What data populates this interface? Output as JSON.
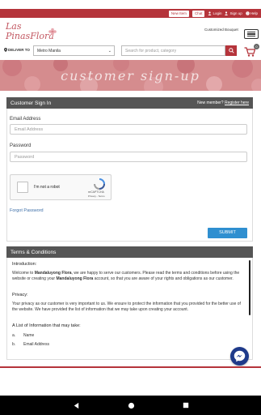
{
  "topbar": {
    "badge": "New Item",
    "chat": "Chat",
    "login": "Login",
    "signup": "Sign up",
    "help": "Help"
  },
  "header": {
    "logo_line1": "Las",
    "logo_line2": "PinasFlora",
    "custom_bouquet": "Customized Bouquet",
    "cart_count": "0"
  },
  "search": {
    "deliver_label": "DELIVER TO",
    "city_value": "Metro Manila",
    "placeholder": "Search for product, category"
  },
  "banner": {
    "title": "customer sign-up"
  },
  "signin": {
    "title": "Customer Sign In",
    "new_member": "New member?",
    "register": "Register here",
    "email_label": "Email Address",
    "email_placeholder": "Email Address",
    "password_label": "Password",
    "password_placeholder": "Password",
    "captcha_label": "I'm not a robot",
    "captcha_brand": "reCAPTCHA",
    "captcha_terms": "Privacy - Terms",
    "forgot": "Forgot Password",
    "submit": "SUBMIT"
  },
  "terms": {
    "title": "Terms & Conditions",
    "intro_heading": "Introduction:",
    "intro_text_a": "Welcome to ",
    "intro_brand_a": "Mandaluyong Flora",
    "intro_text_b": ", we are happy to serve our customers. Please read the terms and conditions before using the website or creating your ",
    "intro_brand_b": "Mandaluyong Flora",
    "intro_text_c": " account, so that you are aware of your rights and obligations as our customer.",
    "privacy_heading": "Privacy:",
    "privacy_text": "Your privacy as our customer is very important to us. We ensure to protect the information that you provided for the better use of the website. We have provided the list of information that we may take upon creating your account.",
    "list_heading": "A List of Information that may take:",
    "items": [
      {
        "marker": "a.",
        "label": "Name"
      },
      {
        "marker": "b.",
        "label": "Email Address"
      }
    ]
  }
}
